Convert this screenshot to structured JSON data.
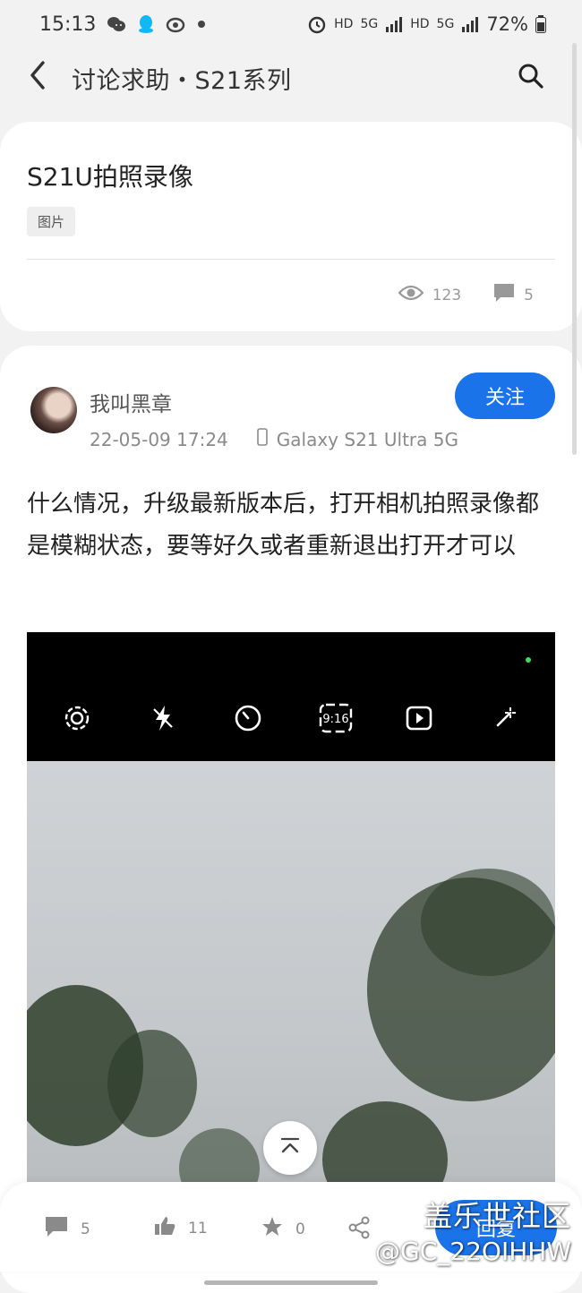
{
  "status_bar": {
    "time": "15:13",
    "network_1": "HD",
    "network_2": "5G",
    "network_3": "HD",
    "network_4": "5G",
    "battery": "72%"
  },
  "app_bar": {
    "title": "讨论求助・S21系列"
  },
  "post_header": {
    "title": "S21U拍照录像",
    "tag": "图片",
    "views": "123",
    "comments": "5"
  },
  "post": {
    "username": "我叫黑章",
    "datetime": "22-05-09 17:24",
    "device": "Galaxy S21 Ultra 5G",
    "follow_label": "关注",
    "body": "什么情况，升级最新版本后，打开相机拍照录像都是模糊状态，要等好久或者重新退出打开才可以"
  },
  "camera_ui": {
    "ratio_label": "9:16"
  },
  "bottom_bar": {
    "comments": "5",
    "likes": "11",
    "favorites": "0",
    "reply_label": "回复"
  },
  "watermark": {
    "line1": "盖乐世社区",
    "line2": "@GC_22OIHHW"
  },
  "colors": {
    "accent": "#1a73e8",
    "background": "#f2f2f2",
    "card": "#ffffff"
  }
}
